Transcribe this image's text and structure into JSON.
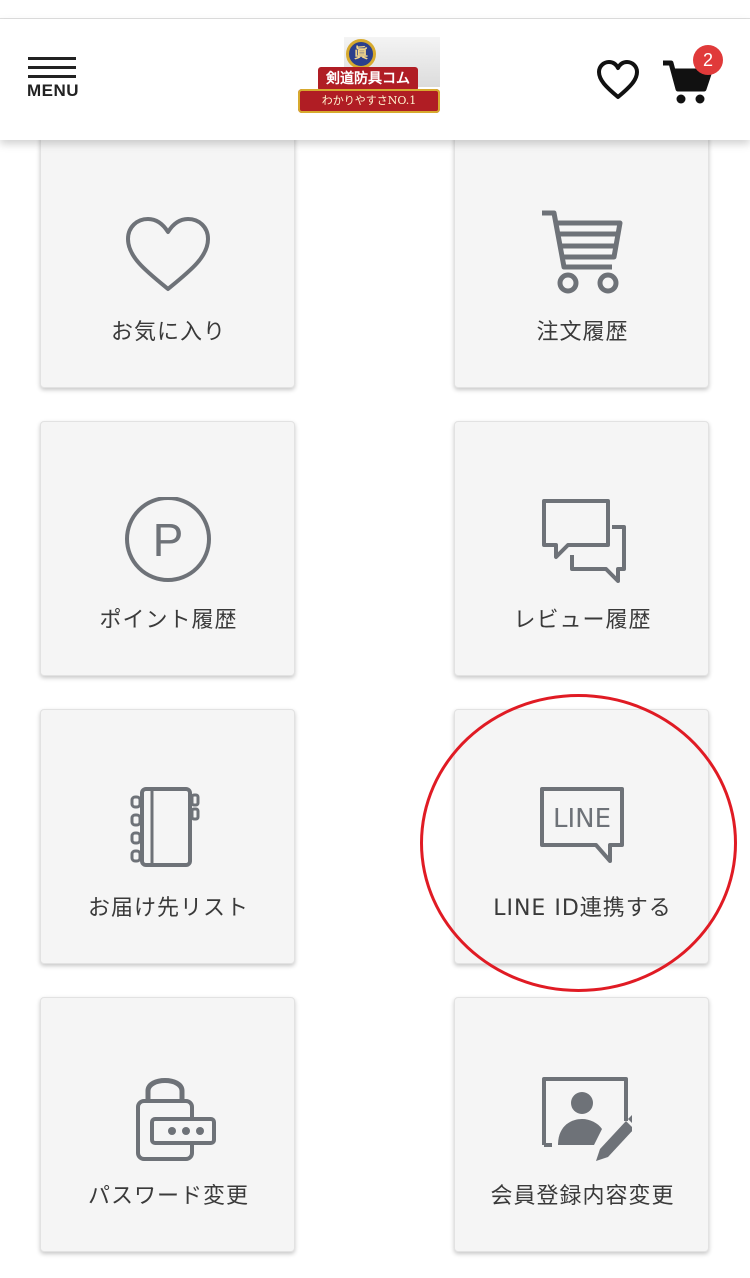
{
  "header": {
    "menu_label": "MENU",
    "logo": {
      "emblem_text": "眞",
      "brand_text": "剣道防具コム",
      "tagline": "わかりやすさNO.1"
    },
    "cart_count": "2"
  },
  "colors": {
    "icon_gray": "#6e7278",
    "badge_red": "#e03a3a",
    "highlight_red": "#e01b24",
    "card_bg": "#f5f5f5"
  },
  "menu_cards": [
    {
      "label": "お気に入り",
      "icon": "heart-icon"
    },
    {
      "label": "注文履歴",
      "icon": "cart-icon"
    },
    {
      "label": "ポイント履歴",
      "icon": "point-icon"
    },
    {
      "label": "レビュー履歴",
      "icon": "speech-bubbles-icon"
    },
    {
      "label": "お届け先リスト",
      "icon": "address-book-icon"
    },
    {
      "label": "LINE ID連携する",
      "icon": "line-icon",
      "icon_text": "LINE"
    },
    {
      "label": "パスワード変更",
      "icon": "lock-password-icon"
    },
    {
      "label": "会員登録内容変更",
      "icon": "profile-edit-icon"
    }
  ]
}
